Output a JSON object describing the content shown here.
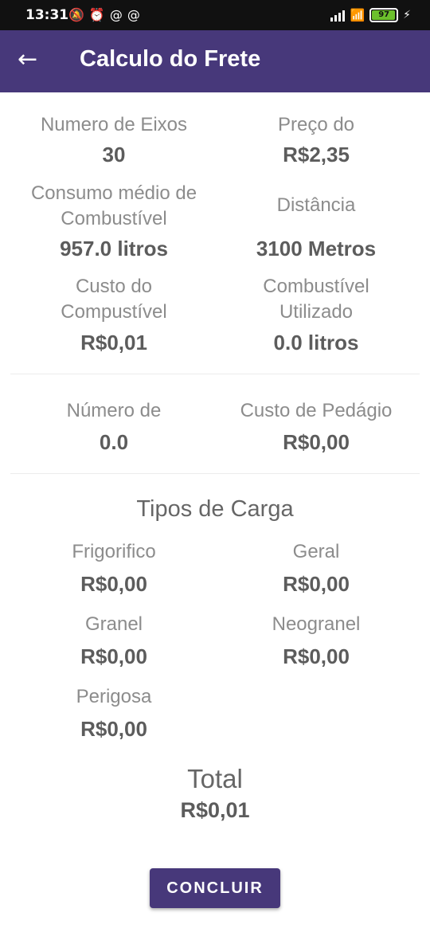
{
  "status_bar": {
    "time": "13:31",
    "left_icons": [
      "muted-bell",
      "alarm",
      "at-sign",
      "at-sign"
    ],
    "battery_level": "97",
    "battery_fraction": 0.97
  },
  "app_bar": {
    "title": "Calculo do Frete",
    "color": "#47387a"
  },
  "fields": {
    "numero_eixos": {
      "label": "Numero de Eixos",
      "value": "30"
    },
    "preco_do": {
      "label": "Preço do",
      "value": "R$2,35"
    },
    "consumo_medio": {
      "label": "Consumo médio de Combustível",
      "value": "957.0 litros"
    },
    "distancia": {
      "label": "Distância",
      "value": "3100 Metros"
    },
    "custo_combustivel": {
      "label": "Custo do Compustível",
      "value": "R$0,01"
    },
    "combustivel_utilizado": {
      "label": "Combustível Utilizado",
      "value": "0.0 litros"
    },
    "numero_pedagios": {
      "label": "Número de",
      "value": "0.0"
    },
    "custo_pedagio": {
      "label": "Custo de Pedágio",
      "value": "R$0,00"
    }
  },
  "tipos_carga": {
    "title": "Tipos de Carga",
    "items": [
      {
        "label": "Frigorifico",
        "value": "R$0,00"
      },
      {
        "label": "Geral",
        "value": "R$0,00"
      },
      {
        "label": "Granel",
        "value": "R$0,00"
      },
      {
        "label": "Neogranel",
        "value": "R$0,00"
      },
      {
        "label": "Perigosa",
        "value": "R$0,00"
      }
    ]
  },
  "total": {
    "label": "Total",
    "value": "R$0,01"
  },
  "button": {
    "label": "CONCLUIR"
  }
}
